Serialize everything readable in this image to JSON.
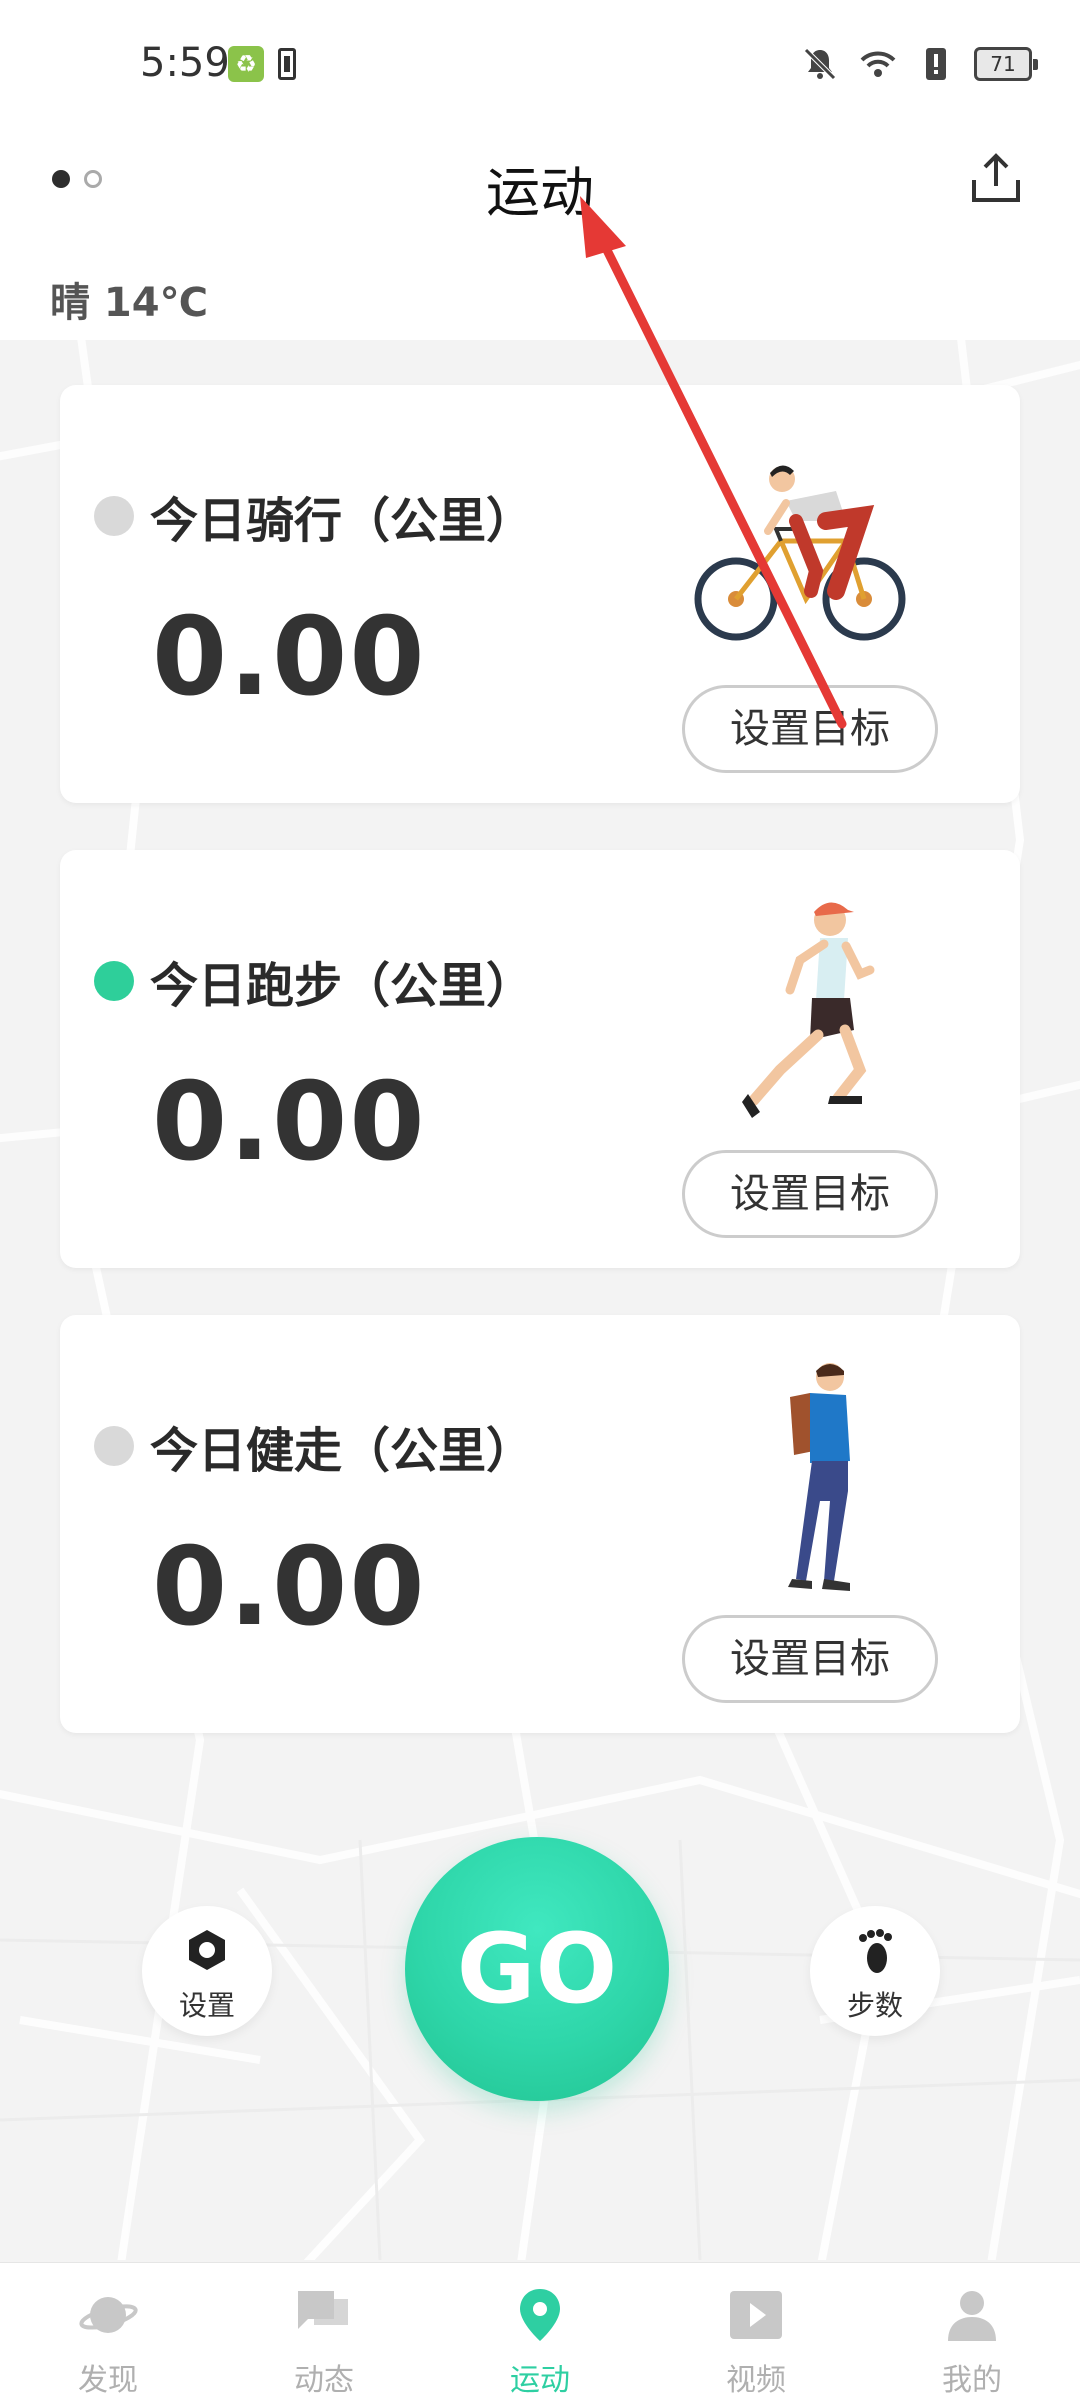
{
  "status_bar": {
    "time": "5:59",
    "battery": "71"
  },
  "header": {
    "title": "运动",
    "weather": "晴 14℃"
  },
  "cards": [
    {
      "title": "今日骑行（公里）",
      "value": "0.00",
      "goal_label": "设置目标",
      "dot_color": "#d9d9d9"
    },
    {
      "title": "今日跑步（公里）",
      "value": "0.00",
      "goal_label": "设置目标",
      "dot_color": "#2ecf9a"
    },
    {
      "title": "今日健走（公里）",
      "value": "0.00",
      "goal_label": "设置目标",
      "dot_color": "#d9d9d9"
    }
  ],
  "controls": {
    "settings_label": "设置",
    "go_label": "GO",
    "steps_label": "步数"
  },
  "tabbar": {
    "items": [
      {
        "label": "发现",
        "icon": "planet-icon"
      },
      {
        "label": "动态",
        "icon": "chat-icon"
      },
      {
        "label": "运动",
        "icon": "location-pin-icon",
        "active": true
      },
      {
        "label": "视频",
        "icon": "play-icon"
      },
      {
        "label": "我的",
        "icon": "person-icon"
      }
    ]
  },
  "colors": {
    "accent": "#2ecfa2",
    "inactive": "#b0b0b0"
  }
}
